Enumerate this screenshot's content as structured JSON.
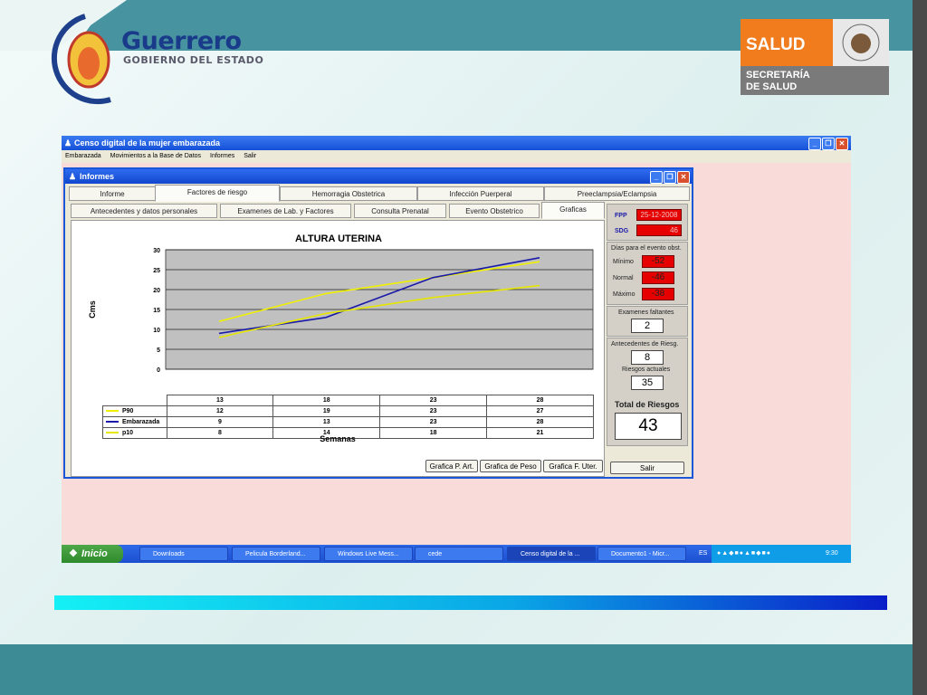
{
  "slide": {
    "govt_name": "Guerrero",
    "govt_subtitle": "GOBIERNO DEL ESTADO",
    "salud_word": "SALUD",
    "salud_line1": "SECRETARÍA",
    "salud_line2": "DE SALUD"
  },
  "app": {
    "title": "Censo digital de la mujer embarazada",
    "menu": [
      "Embarazada",
      "Movimientos a la Base de Datos",
      "Informes",
      "Salir"
    ]
  },
  "dialog": {
    "title": "Informes",
    "tabs_row1": [
      "Informe",
      "Factores de riesgo",
      "Hemorragia Obstetrica",
      "Infección Puerperal",
      "Preeclampsia/Eclampsia"
    ],
    "tabs_row2": [
      "Antecedentes y datos personales",
      "Examenes de Lab. y Factores",
      "Consulta Prenatal",
      "Evento Obstetrico",
      "Graficas"
    ],
    "active_tab_row1": "Factores de riesgo",
    "active_tab_row2": "Graficas",
    "buttons": [
      "Grafica P. Art.",
      "Grafica de Peso",
      "Grafica F. Uter."
    ]
  },
  "chart_data": {
    "type": "line",
    "title": "ALTURA UTERINA",
    "xlabel": "Semanas",
    "ylabel": "Cms",
    "categories": [
      "13",
      "18",
      "23",
      "28"
    ],
    "ylim": [
      0,
      30
    ],
    "yticks": [
      "0",
      "5",
      "10",
      "15",
      "20",
      "25",
      "30"
    ],
    "grid": true,
    "series": [
      {
        "name": "P90",
        "values": [
          12,
          19,
          23,
          27
        ],
        "color": "#f0f000"
      },
      {
        "name": "Embarazada",
        "values": [
          9,
          13,
          23,
          28
        ],
        "color": "#1a1aa8"
      },
      {
        "name": "p10",
        "values": [
          8,
          14,
          18,
          21
        ],
        "color": "#e6e600"
      }
    ]
  },
  "right_panel": {
    "fpp_label": "FPP",
    "fpp_value": "25-12-2008",
    "sdg_label": "SDG",
    "sdg_value": "46",
    "dias_title": "Días para el evento obst.",
    "minimo_label": "Mínimo",
    "minimo_value": "-52",
    "normal_label": "Normal",
    "normal_value": "-46",
    "maximo_label": "Máximo",
    "maximo_value": "-38",
    "faltantes_label": "Examenes faltantes",
    "faltantes_value": "2",
    "antecedentes_label": "Antecedentes de Riesg.",
    "antecedentes_value": "8",
    "actuales_label": "Riesgos actuales",
    "actuales_value": "35",
    "total_label": "Total de Riesgos",
    "total_value": "43",
    "salir_label": "Salir"
  },
  "taskbar": {
    "start_label": "Inicio",
    "tasks": [
      "Downloads",
      "Pelicula Borderland...",
      "Windows Live Mess...",
      "cede",
      "Censo digital de la ...",
      "Documento1 - Micr..."
    ],
    "lang": "ES",
    "clock": "9:30"
  }
}
